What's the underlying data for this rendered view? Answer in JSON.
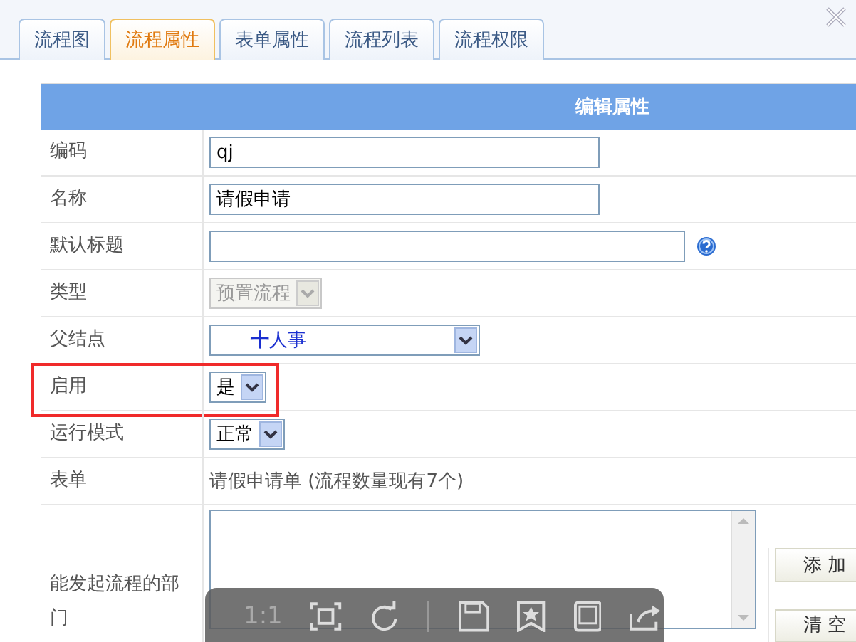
{
  "tabs": [
    {
      "label": "流程图",
      "selected": false
    },
    {
      "label": "流程属性",
      "selected": true
    },
    {
      "label": "表单属性",
      "selected": false
    },
    {
      "label": "流程列表",
      "selected": false
    },
    {
      "label": "流程权限",
      "selected": false
    }
  ],
  "panel": {
    "title": "编辑属性"
  },
  "rows": [
    {
      "label": "编码",
      "kind": "input",
      "value": "qj",
      "highlighted": false
    },
    {
      "label": "名称",
      "kind": "input",
      "value": "请假申请",
      "highlighted": false
    },
    {
      "label": "默认标题",
      "kind": "wide-input",
      "value": "",
      "help": true,
      "highlighted": false
    },
    {
      "label": "类型",
      "kind": "select",
      "value": "预置流程",
      "disabled": true,
      "highlighted": false
    },
    {
      "label": "父结点",
      "kind": "tree-select",
      "prefix": "十",
      "value": "人事",
      "disabled": false,
      "highlighted": false
    },
    {
      "label": "启用",
      "kind": "select",
      "value": "是",
      "disabled": false,
      "highlighted": true
    },
    {
      "label": "运行模式",
      "kind": "select",
      "value": "正常",
      "disabled": false,
      "highlighted": false
    },
    {
      "label": "表单",
      "kind": "text",
      "value": "请假申请单 (流程数量现有7个)",
      "highlighted": false
    },
    {
      "label": "能发起流程的部门",
      "kind": "textarea",
      "buttons": [
        "添 加",
        "清 空"
      ],
      "highlighted": false
    }
  ],
  "viewer_toolbar": {
    "zoom_label": "1:1"
  }
}
